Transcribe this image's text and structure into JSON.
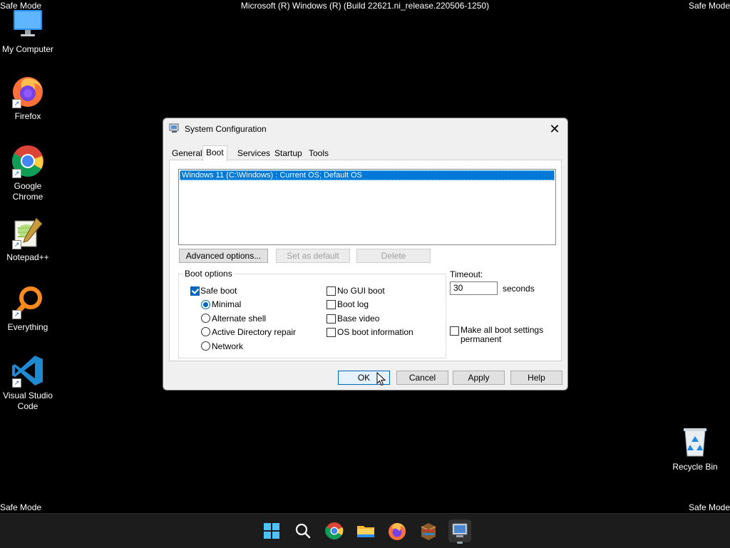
{
  "screen": {
    "mode_label": "Safe Mode",
    "build_text": "Microsoft (R) Windows (R) (Build 22621.ni_release.220506-1250)"
  },
  "desktop": {
    "icons": [
      {
        "label": "My Computer",
        "icon": "computer-icon"
      },
      {
        "label": "Firefox",
        "icon": "firefox-icon"
      },
      {
        "label": "Google Chrome",
        "icon": "chrome-icon"
      },
      {
        "label": "Notepad++",
        "icon": "notepadpp-icon"
      },
      {
        "label": "Everything",
        "icon": "everything-icon"
      },
      {
        "label": "Visual Studio Code",
        "icon": "vscode-icon"
      },
      {
        "label": "Recycle Bin",
        "icon": "recycle-bin-icon"
      }
    ]
  },
  "dialog": {
    "title": "System Configuration",
    "tabs": [
      {
        "label": "General",
        "active": false
      },
      {
        "label": "Boot",
        "active": true
      },
      {
        "label": "Services",
        "active": false
      },
      {
        "label": "Startup",
        "active": false
      },
      {
        "label": "Tools",
        "active": false
      }
    ],
    "os_list": [
      "Windows 11 (C:\\Windows) : Current OS; Default OS"
    ],
    "buttons_row": {
      "advanced": "Advanced options...",
      "set_default": "Set as default",
      "delete": "Delete"
    },
    "boot_options": {
      "group_label": "Boot options",
      "safe_boot": {
        "label": "Safe boot",
        "checked": true
      },
      "minimal": {
        "label": "Minimal",
        "checked": true
      },
      "alternate_shell": {
        "label": "Alternate shell",
        "checked": false
      },
      "ad_repair": {
        "label": "Active Directory repair",
        "checked": false
      },
      "network": {
        "label": "Network",
        "checked": false
      },
      "no_gui_boot": {
        "label": "No GUI boot",
        "checked": false
      },
      "boot_log": {
        "label": "Boot log",
        "checked": false
      },
      "base_video": {
        "label": "Base video",
        "checked": false
      },
      "os_boot_info": {
        "label": "OS boot information",
        "checked": false
      }
    },
    "timeout": {
      "label": "Timeout:",
      "value": "30",
      "unit": "seconds"
    },
    "make_permanent": {
      "label_line1": "Make all boot settings",
      "label_line2": "permanent",
      "checked": false
    },
    "footer": {
      "ok": "OK",
      "cancel": "Cancel",
      "apply": "Apply",
      "help": "Help"
    }
  },
  "taskbar": {
    "items": [
      "start-icon",
      "search-icon",
      "chrome-icon",
      "file-explorer-icon",
      "firefox-icon",
      "winrar-icon",
      "msconfig-icon"
    ]
  }
}
